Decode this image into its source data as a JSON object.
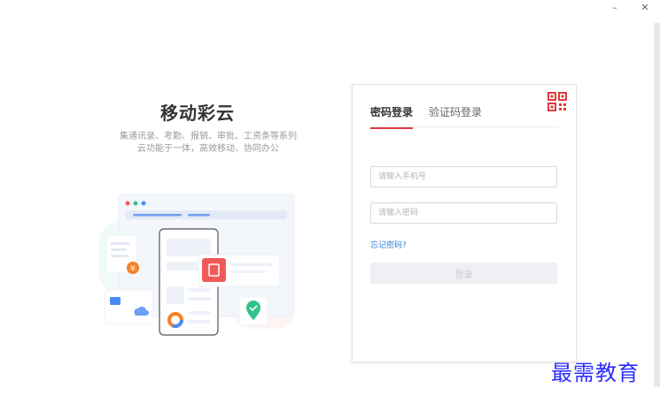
{
  "window": {
    "minimize": "–",
    "close": "✕"
  },
  "hero": {
    "title": "移动彩云",
    "subtitle_line1": "集通讯录、考勤、报销、审批、工资条等系列",
    "subtitle_line2": "云功能于一体，高效移动、协同办公"
  },
  "login": {
    "tabs": [
      {
        "label": "密码登录",
        "active": true
      },
      {
        "label": "验证码登录",
        "active": false
      }
    ],
    "phone_placeholder": "请输入手机号",
    "password_placeholder": "请输入密码",
    "forgot_label": "忘记密码?",
    "submit_label": "登录"
  },
  "illustration": {
    "yen_symbol": "¥"
  },
  "watermark": "最需教育",
  "colors": {
    "accent": "#e0393e",
    "link": "#3a7bd5",
    "watermark": "#2d2dff"
  }
}
